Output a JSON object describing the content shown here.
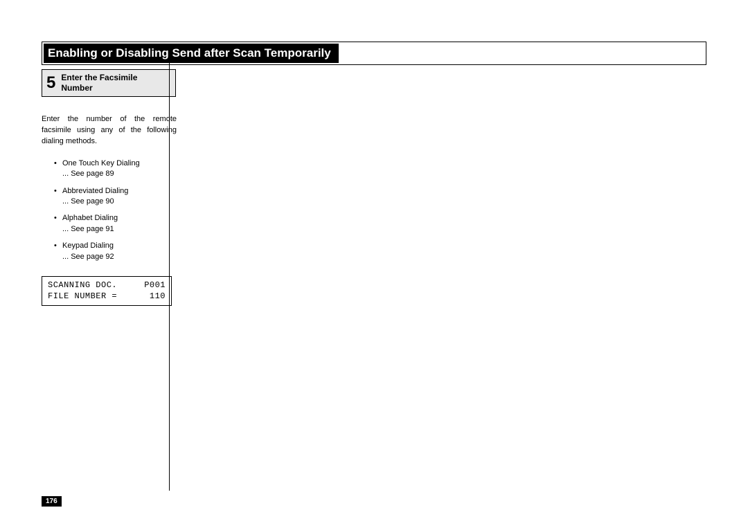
{
  "header": {
    "title": "Enabling or Disabling Send after Scan Temporarily"
  },
  "step": {
    "number": "5",
    "title_l1": "Enter the Facsimile",
    "title_l2": "Number"
  },
  "lead": "Enter the number of the remote facsimile using any of the following dialing methods.",
  "bullets": [
    {
      "label": "One Touch Key Dialing",
      "ref": "... See page 89"
    },
    {
      "label": "Abbreviated Dialing",
      "ref": "... See page 90"
    },
    {
      "label": "Alphabet Dialing",
      "ref": "... See page 91"
    },
    {
      "label": "Keypad Dialing",
      "ref": "... See page 92"
    }
  ],
  "lcd": {
    "line1_left": "SCANNING DOC.",
    "line1_right": "P001",
    "line2_left": "FILE NUMBER =",
    "line2_right": " 110"
  },
  "page_number": "176"
}
